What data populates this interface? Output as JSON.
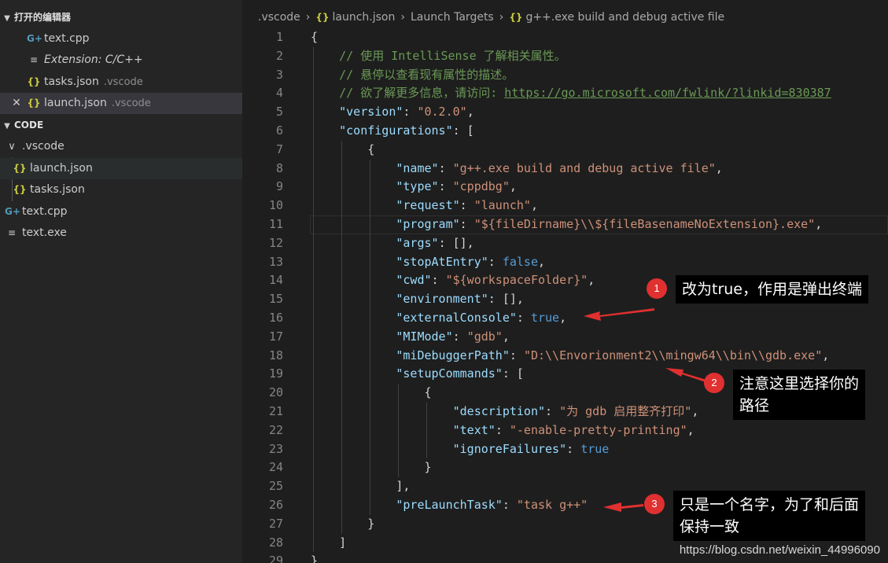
{
  "sidebar": {
    "open_editors_header": "打开的编辑器",
    "open_editors": [
      {
        "icon": "cpp-file-icon",
        "name": "text.cpp",
        "desc": ""
      },
      {
        "icon": "extension-icon",
        "name": "Extension: C/C++",
        "desc": ""
      },
      {
        "icon": "json-file-icon",
        "name": "tasks.json",
        "desc": ".vscode"
      },
      {
        "icon": "json-file-icon",
        "name": "launch.json",
        "desc": ".vscode"
      }
    ],
    "folder_header": "CODE",
    "tree": [
      {
        "name": ".vscode"
      },
      {
        "name": "launch.json"
      },
      {
        "name": "tasks.json"
      },
      {
        "name": "text.cpp"
      },
      {
        "name": "text.exe"
      }
    ]
  },
  "breadcrumb": [
    ".vscode",
    "launch.json",
    "Launch Targets",
    "g++.exe build and debug active file"
  ],
  "code_lines": [
    {
      "n": "1",
      "t": "{"
    },
    {
      "n": "2",
      "t": "    // 使用 IntelliSense 了解相关属性。"
    },
    {
      "n": "3",
      "t": "    // 悬停以查看现有属性的描述。"
    },
    {
      "n": "4",
      "t": "    // 欲了解更多信息，请访问: https://go.microsoft.com/fwlink/?linkid=830387"
    },
    {
      "n": "5",
      "t": "    \"version\": \"0.2.0\","
    },
    {
      "n": "6",
      "t": "    \"configurations\": ["
    },
    {
      "n": "7",
      "t": "        {"
    },
    {
      "n": "8",
      "t": "            \"name\": \"g++.exe build and debug active file\","
    },
    {
      "n": "9",
      "t": "            \"type\": \"cppdbg\","
    },
    {
      "n": "10",
      "t": "            \"request\": \"launch\","
    },
    {
      "n": "11",
      "t": "            \"program\": \"${fileDirname}\\\\${fileBasenameNoExtension}.exe\","
    },
    {
      "n": "12",
      "t": "            \"args\": [],"
    },
    {
      "n": "13",
      "t": "            \"stopAtEntry\": false,"
    },
    {
      "n": "14",
      "t": "            \"cwd\": \"${workspaceFolder}\","
    },
    {
      "n": "15",
      "t": "            \"environment\": [],"
    },
    {
      "n": "16",
      "t": "            \"externalConsole\": true,"
    },
    {
      "n": "17",
      "t": "            \"MIMode\": \"gdb\","
    },
    {
      "n": "18",
      "t": "            \"miDebuggerPath\": \"D:\\\\Envorionment2\\\\mingw64\\\\bin\\\\gdb.exe\","
    },
    {
      "n": "19",
      "t": "            \"setupCommands\": ["
    },
    {
      "n": "20",
      "t": "                {"
    },
    {
      "n": "21",
      "t": "                    \"description\": \"为 gdb 启用整齐打印\","
    },
    {
      "n": "22",
      "t": "                    \"text\": \"-enable-pretty-printing\","
    },
    {
      "n": "23",
      "t": "                    \"ignoreFailures\": true"
    },
    {
      "n": "24",
      "t": "                }"
    },
    {
      "n": "25",
      "t": "            ],"
    },
    {
      "n": "26",
      "t": "            \"preLaunchTask\": \"task g++\""
    },
    {
      "n": "27",
      "t": "        }"
    },
    {
      "n": "28",
      "t": "    ]"
    },
    {
      "n": "29",
      "t": "}"
    }
  ],
  "annotations": [
    {
      "num": "1",
      "text": "改为true，作用是弹出终端"
    },
    {
      "num": "2",
      "text_line1": "注意这里选择你的",
      "text_line2": "路径"
    },
    {
      "num": "3",
      "text_line1": "只是一个名字，为了和后面",
      "text_line2": "保持一致"
    }
  ],
  "watermark": "https://blog.csdn.net/weixin_44996090",
  "colors": {
    "annotation_red": "#e03030",
    "keyword": "#9cdcfe",
    "string": "#ce9178",
    "comment": "#6a9955",
    "boolean": "#569cd6"
  }
}
